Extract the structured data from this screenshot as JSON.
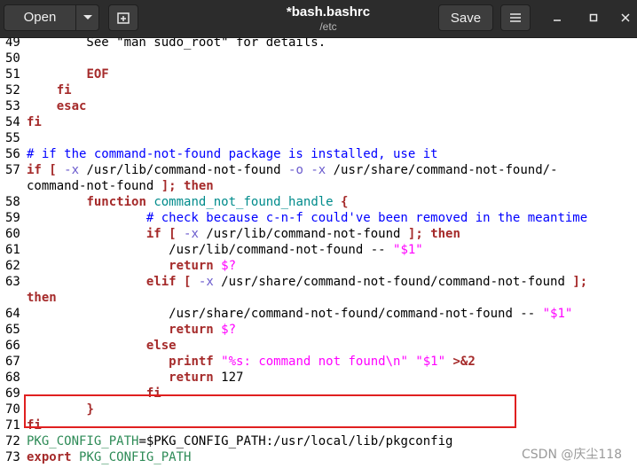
{
  "header": {
    "open_label": "Open",
    "save_label": "Save",
    "title": "*bash.bashrc",
    "subtitle": "/etc"
  },
  "icons": {
    "dropdown": "chevron-down-icon",
    "new_tab": "new-tab-icon",
    "menu": "hamburger-menu-icon",
    "minimize": "minimize-icon",
    "maximize": "maximize-icon",
    "close": "close-icon"
  },
  "lines": [
    {
      "n": "49",
      "segs": [
        {
          "t": "        See \"man sudo_root\" for details.",
          "c": ""
        }
      ]
    },
    {
      "n": "50",
      "segs": [
        {
          "t": "",
          "c": ""
        }
      ]
    },
    {
      "n": "51",
      "segs": [
        {
          "t": "        ",
          "c": ""
        },
        {
          "t": "EOF",
          "c": "kw"
        }
      ]
    },
    {
      "n": "52",
      "segs": [
        {
          "t": "    ",
          "c": ""
        },
        {
          "t": "fi",
          "c": "kw"
        }
      ]
    },
    {
      "n": "53",
      "segs": [
        {
          "t": "    ",
          "c": ""
        },
        {
          "t": "esac",
          "c": "kw"
        }
      ]
    },
    {
      "n": "54",
      "segs": [
        {
          "t": "fi",
          "c": "kw"
        }
      ]
    },
    {
      "n": "55",
      "segs": [
        {
          "t": "",
          "c": ""
        }
      ]
    },
    {
      "n": "56",
      "segs": [
        {
          "t": "# if the command-not-found package is installed, use it",
          "c": "cm"
        }
      ]
    },
    {
      "n": "57",
      "segs": [
        {
          "t": "if",
          "c": "kw"
        },
        {
          "t": " ",
          "c": ""
        },
        {
          "t": "[",
          "c": "kw"
        },
        {
          "t": " ",
          "c": ""
        },
        {
          "t": "-x",
          "c": "op"
        },
        {
          "t": " /usr/lib/command-not-found ",
          "c": ""
        },
        {
          "t": "-o",
          "c": "op"
        },
        {
          "t": " ",
          "c": ""
        },
        {
          "t": "-x",
          "c": "op"
        },
        {
          "t": " /usr/share/command-not-found/-",
          "c": ""
        }
      ]
    },
    {
      "n": "",
      "segs": [
        {
          "t": "command-not-found ",
          "c": ""
        },
        {
          "t": "];",
          "c": "kw"
        },
        {
          "t": " ",
          "c": ""
        },
        {
          "t": "then",
          "c": "kw"
        }
      ]
    },
    {
      "n": "58",
      "segs": [
        {
          "t": "        ",
          "c": ""
        },
        {
          "t": "function",
          "c": "kw"
        },
        {
          "t": " ",
          "c": ""
        },
        {
          "t": "command_not_found_handle",
          "c": "fn"
        },
        {
          "t": " ",
          "c": ""
        },
        {
          "t": "{",
          "c": "kw"
        }
      ]
    },
    {
      "n": "59",
      "segs": [
        {
          "t": "                ",
          "c": ""
        },
        {
          "t": "# check because c-n-f could've been removed in the meantime",
          "c": "cm"
        }
      ]
    },
    {
      "n": "60",
      "segs": [
        {
          "t": "                ",
          "c": ""
        },
        {
          "t": "if",
          "c": "kw"
        },
        {
          "t": " ",
          "c": ""
        },
        {
          "t": "[",
          "c": "kw"
        },
        {
          "t": " ",
          "c": ""
        },
        {
          "t": "-x",
          "c": "op"
        },
        {
          "t": " /usr/lib/command-not-found ",
          "c": ""
        },
        {
          "t": "];",
          "c": "kw"
        },
        {
          "t": " ",
          "c": ""
        },
        {
          "t": "then",
          "c": "kw"
        }
      ]
    },
    {
      "n": "61",
      "segs": [
        {
          "t": "                   /usr/lib/command-not-found -- ",
          "c": ""
        },
        {
          "t": "\"$1\"",
          "c": "st"
        }
      ]
    },
    {
      "n": "62",
      "segs": [
        {
          "t": "                   ",
          "c": ""
        },
        {
          "t": "return",
          "c": "kw"
        },
        {
          "t": " ",
          "c": ""
        },
        {
          "t": "$?",
          "c": "st"
        }
      ]
    },
    {
      "n": "63",
      "segs": [
        {
          "t": "                ",
          "c": ""
        },
        {
          "t": "elif",
          "c": "kw"
        },
        {
          "t": " ",
          "c": ""
        },
        {
          "t": "[",
          "c": "kw"
        },
        {
          "t": " ",
          "c": ""
        },
        {
          "t": "-x",
          "c": "op"
        },
        {
          "t": " /usr/share/command-not-found/command-not-found ",
          "c": ""
        },
        {
          "t": "];",
          "c": "kw"
        }
      ]
    },
    {
      "n": "",
      "segs": [
        {
          "t": "then",
          "c": "kw"
        }
      ]
    },
    {
      "n": "64",
      "segs": [
        {
          "t": "                   /usr/share/command-not-found/command-not-found -- ",
          "c": ""
        },
        {
          "t": "\"$1\"",
          "c": "st"
        }
      ]
    },
    {
      "n": "65",
      "segs": [
        {
          "t": "                   ",
          "c": ""
        },
        {
          "t": "return",
          "c": "kw"
        },
        {
          "t": " ",
          "c": ""
        },
        {
          "t": "$?",
          "c": "st"
        }
      ]
    },
    {
      "n": "66",
      "segs": [
        {
          "t": "                ",
          "c": ""
        },
        {
          "t": "else",
          "c": "kw"
        }
      ]
    },
    {
      "n": "67",
      "segs": [
        {
          "t": "                   ",
          "c": ""
        },
        {
          "t": "printf",
          "c": "kw"
        },
        {
          "t": " ",
          "c": ""
        },
        {
          "t": "\"%s: command not found\\n\"",
          "c": "st"
        },
        {
          "t": " ",
          "c": ""
        },
        {
          "t": "\"$1\"",
          "c": "st"
        },
        {
          "t": " ",
          "c": ""
        },
        {
          "t": ">&2",
          "c": "kw"
        }
      ]
    },
    {
      "n": "68",
      "segs": [
        {
          "t": "                   ",
          "c": ""
        },
        {
          "t": "return",
          "c": "kw"
        },
        {
          "t": " 127",
          "c": ""
        }
      ]
    },
    {
      "n": "69",
      "segs": [
        {
          "t": "                ",
          "c": ""
        },
        {
          "t": "fi",
          "c": "kw"
        }
      ]
    },
    {
      "n": "70",
      "segs": [
        {
          "t": "        ",
          "c": ""
        },
        {
          "t": "}",
          "c": "kw"
        }
      ]
    },
    {
      "n": "71",
      "segs": [
        {
          "t": "fi",
          "c": "kw"
        }
      ]
    },
    {
      "n": "72",
      "segs": [
        {
          "t": "PKG_CONFIG_PATH",
          "c": "pk"
        },
        {
          "t": "=$PKG_CONFIG_PATH:/usr/local/lib/pkgconfig",
          "c": ""
        }
      ]
    },
    {
      "n": "73",
      "segs": [
        {
          "t": "export",
          "c": "kw"
        },
        {
          "t": " ",
          "c": ""
        },
        {
          "t": "PKG_CONFIG_PATH",
          "c": "pk"
        }
      ]
    }
  ],
  "watermark": "CSDN @庆尘118",
  "colors": {
    "header_bg": "#2c2c2c",
    "keyword": "#a52a2a",
    "comment": "#0000ff",
    "string": "#ff00ff",
    "highlight_box": "#e02020"
  }
}
